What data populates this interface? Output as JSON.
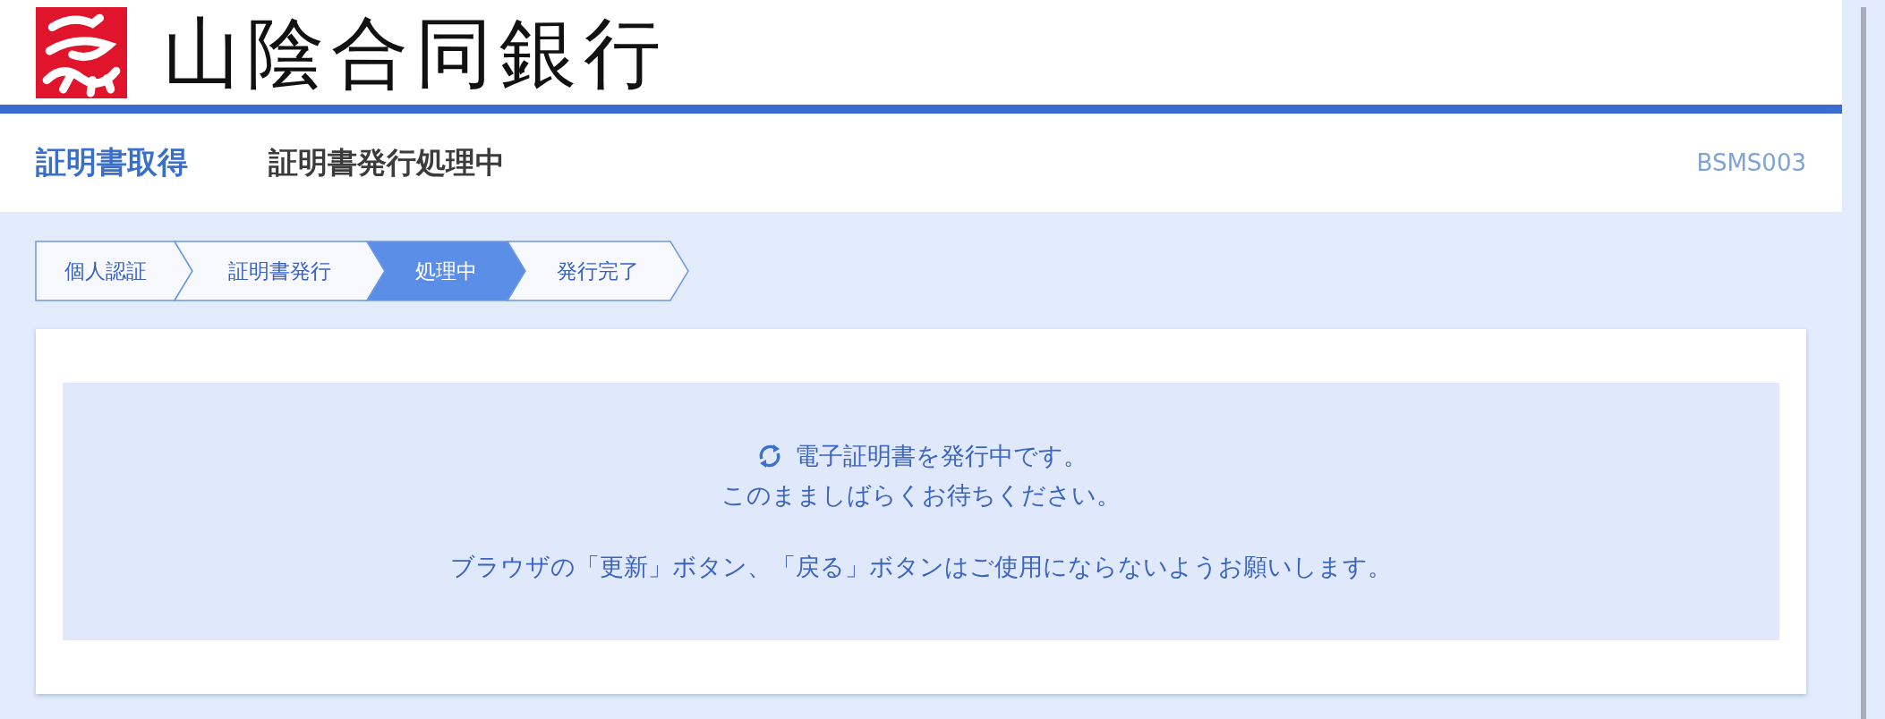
{
  "header": {
    "logo_text": "山陰合同銀行"
  },
  "title_bar": {
    "section": "証明書取得",
    "page_title": "証明書発行処理中",
    "screen_id": "BSMS003"
  },
  "steps": [
    {
      "label": "個人認証",
      "selected": false
    },
    {
      "label": "証明書発行",
      "selected": false
    },
    {
      "label": "処理中",
      "selected": true
    },
    {
      "label": "発行完了",
      "selected": false
    }
  ],
  "message": {
    "lines": [
      "電子証明書を発行中です。",
      "このまましばらくお待ちください。"
    ],
    "notice": "ブラウザの「更新」ボタン、「戻る」ボタンはご使用にならないようお願いします。"
  }
}
